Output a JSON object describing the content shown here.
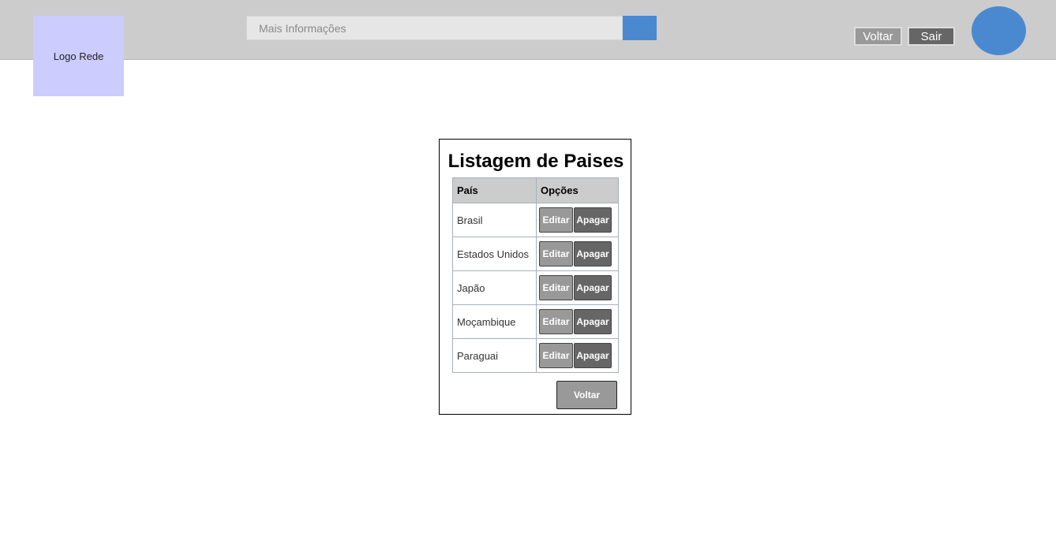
{
  "header": {
    "logo_text": "Logo Rede",
    "search_placeholder": "Mais Informações",
    "voltar_label": "Voltar",
    "sair_label": "Sair",
    "accent_color": "#4a89d0"
  },
  "listing": {
    "title": "Listagem de Paises",
    "columns": [
      "País",
      "Opções"
    ],
    "rows": [
      {
        "pais": "Brasil",
        "edit": "Editar",
        "delete": "Apagar"
      },
      {
        "pais": "Estados Unidos",
        "edit": "Editar",
        "delete": "Apagar"
      },
      {
        "pais": "Japão",
        "edit": "Editar",
        "delete": "Apagar"
      },
      {
        "pais": "Moçambique",
        "edit": "Editar",
        "delete": "Apagar"
      },
      {
        "pais": "Paraguai",
        "edit": "Editar",
        "delete": "Apagar"
      }
    ],
    "back_label": "Voltar"
  }
}
